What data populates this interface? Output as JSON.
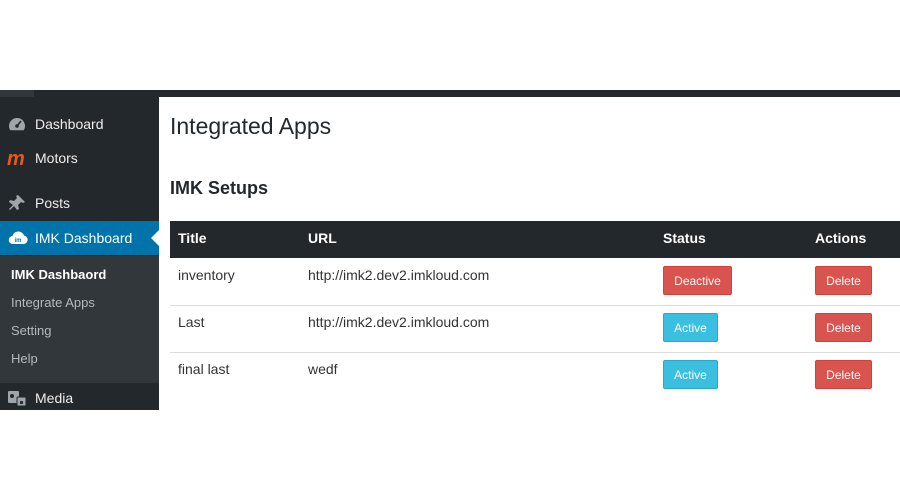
{
  "colors": {
    "admin_bar": "#23282d",
    "sidebar_bg": "#23282d",
    "submenu_bg": "#32373c",
    "current_menu": "#0073aa",
    "danger": "#d9534f",
    "info": "#3bbfe0",
    "motors_icon": "#e8571e"
  },
  "sidebar": {
    "items": [
      {
        "label": "Dashboard",
        "icon": "dashboard-gauge-icon"
      },
      {
        "label": "Motors",
        "icon": "motors-logo-icon"
      },
      {
        "label": "Posts",
        "icon": "pushpin-icon"
      },
      {
        "label": "IMK Dashboard",
        "icon": "imk-cloud-icon"
      },
      {
        "label": "Media",
        "icon": "media-icon"
      }
    ],
    "submenu": [
      {
        "label": "IMK Dashbaord"
      },
      {
        "label": "Integrate Apps"
      },
      {
        "label": "Setting"
      },
      {
        "label": "Help"
      }
    ]
  },
  "page": {
    "title": "Integrated Apps",
    "section_title": "IMK Setups"
  },
  "table": {
    "columns": [
      "Title",
      "URL",
      "Status",
      "Actions"
    ],
    "rows": [
      {
        "title": "inventory",
        "url": "http://imk2.dev2.imkloud.com",
        "status": "Deactive",
        "action": "Delete"
      },
      {
        "title": "Last",
        "url": "http://imk2.dev2.imkloud.com",
        "status": "Active",
        "action": "Delete"
      },
      {
        "title": "final last",
        "url": "wedf",
        "status": "Active",
        "action": "Delete"
      }
    ]
  }
}
